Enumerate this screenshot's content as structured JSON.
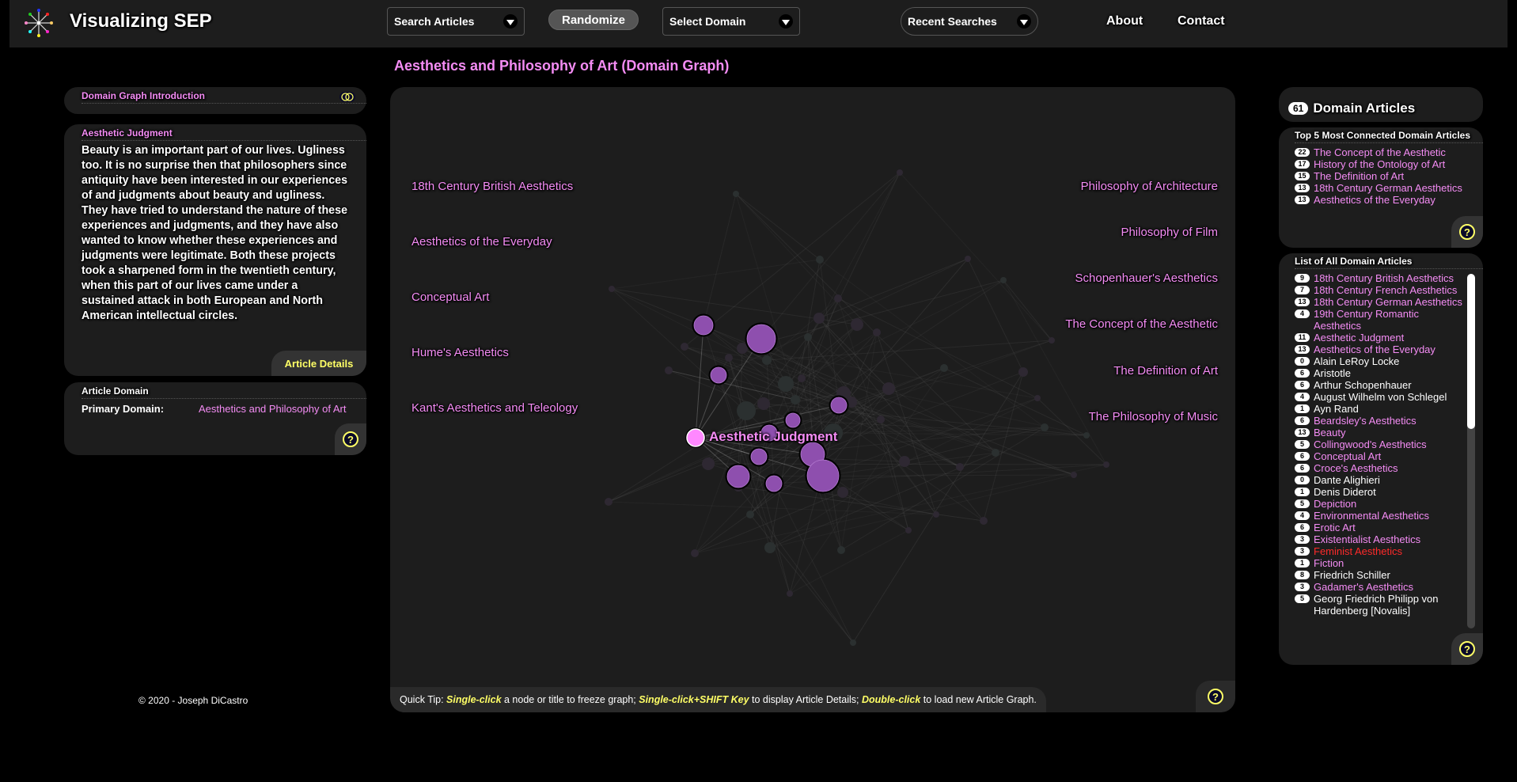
{
  "header": {
    "title": "Visualizing SEP",
    "search_placeholder": "Search Articles",
    "randomize_label": "Randomize",
    "domain_placeholder": "Select Domain",
    "recent_placeholder": "Recent Searches",
    "about_label": "About",
    "contact_label": "Contact"
  },
  "page_title": "Aesthetics and Philosophy of Art (Domain Graph)",
  "left": {
    "intro_heading": "Domain Graph Introduction",
    "article_heading": "Aesthetic Judgment",
    "article_text": "Beauty is an important part of our lives. Ugliness too. It is no surprise then that philosophers since antiquity have been interested in our experiences of and judgments about beauty and ugliness. They have tried to understand the nature of these experiences and judgments, and they have also wanted to know whether these experiences and judgments were legitimate. Both these projects took a sharpened form in the twentieth century, when this part of our lives came under a sustained attack in both European and North American intellectual circles.",
    "article_details_label": "Article Details",
    "domain_heading": "Article Domain",
    "primary_domain_label": "Primary Domain:",
    "primary_domain_value": "Aesthetics and Philosophy of Art",
    "help_label": "?"
  },
  "footer": {
    "copyright": "© 2020 - Joseph DiCastro"
  },
  "graph": {
    "center_label": "Aesthetic Judgment",
    "left_labels": [
      "18th Century British Aesthetics",
      "Aesthetics of the Everyday",
      "Conceptual Art",
      "Hume's Aesthetics",
      "Kant's Aesthetics and Teleology"
    ],
    "right_labels": [
      "Philosophy of Architecture",
      "Philosophy of Film",
      "Schopenhauer's Aesthetics",
      "The Concept of the Aesthetic",
      "The Definition of Art",
      "The Philosophy of Music"
    ],
    "quick_tip": {
      "prefix": "Quick Tip: ",
      "k1": "Single-click",
      "t1": " a node or title to freeze graph; ",
      "k2": "Single-click+SHIFT Key",
      "t2": " to display Article Details; ",
      "k3": "Double-click",
      "t3": " to load new Article Graph."
    },
    "help_label": "?",
    "colors": {
      "active_node": "#ff88ff",
      "neighbor_node": "#8e4fae",
      "faded_node": "#2a2a2e",
      "label": "#f48cf4"
    }
  },
  "right": {
    "count": "61",
    "count_label": "Domain Articles",
    "top5_heading": "Top 5 Most Connected Domain Articles",
    "top5": [
      {
        "n": "22",
        "title": "The Concept of the Aesthetic"
      },
      {
        "n": "17",
        "title": "History of the Ontology of Art"
      },
      {
        "n": "15",
        "title": "The Definition of Art"
      },
      {
        "n": "13",
        "title": "18th Century German Aesthetics"
      },
      {
        "n": "13",
        "title": "Aesthetics of the Everyday"
      }
    ],
    "all_heading": "List of All Domain Articles",
    "all": [
      {
        "n": "9",
        "title": "18th Century British Aesthetics",
        "kind": "topic"
      },
      {
        "n": "7",
        "title": "18th Century French Aesthetics",
        "kind": "topic"
      },
      {
        "n": "13",
        "title": "18th Century German Aesthetics",
        "kind": "topic"
      },
      {
        "n": "4",
        "title": "19th Century Romantic Aesthetics",
        "kind": "topic"
      },
      {
        "n": "11",
        "title": "Aesthetic Judgment",
        "kind": "topic"
      },
      {
        "n": "13",
        "title": "Aesthetics of the Everyday",
        "kind": "topic"
      },
      {
        "n": "0",
        "title": "Alain LeRoy Locke",
        "kind": "person"
      },
      {
        "n": "6",
        "title": "Aristotle",
        "kind": "person"
      },
      {
        "n": "6",
        "title": "Arthur Schopenhauer",
        "kind": "person"
      },
      {
        "n": "4",
        "title": "August Wilhelm von Schlegel",
        "kind": "person"
      },
      {
        "n": "1",
        "title": "Ayn Rand",
        "kind": "person"
      },
      {
        "n": "6",
        "title": "Beardsley's Aesthetics",
        "kind": "topic"
      },
      {
        "n": "13",
        "title": "Beauty",
        "kind": "topic"
      },
      {
        "n": "5",
        "title": "Collingwood's Aesthetics",
        "kind": "topic"
      },
      {
        "n": "6",
        "title": "Conceptual Art",
        "kind": "topic"
      },
      {
        "n": "6",
        "title": "Croce's Aesthetics",
        "kind": "topic"
      },
      {
        "n": "0",
        "title": "Dante Alighieri",
        "kind": "person"
      },
      {
        "n": "1",
        "title": "Denis Diderot",
        "kind": "person"
      },
      {
        "n": "5",
        "title": "Depiction",
        "kind": "topic"
      },
      {
        "n": "4",
        "title": "Environmental Aesthetics",
        "kind": "topic"
      },
      {
        "n": "6",
        "title": "Erotic Art",
        "kind": "topic"
      },
      {
        "n": "3",
        "title": "Existentialist Aesthetics",
        "kind": "topic"
      },
      {
        "n": "3",
        "title": "Feminist Aesthetics",
        "kind": "red"
      },
      {
        "n": "1",
        "title": "Fiction",
        "kind": "topic"
      },
      {
        "n": "8",
        "title": "Friedrich Schiller",
        "kind": "person"
      },
      {
        "n": "3",
        "title": "Gadamer's Aesthetics",
        "kind": "topic"
      },
      {
        "n": "5",
        "title": "Georg Friedrich Philipp von Hardenberg [Novalis]",
        "kind": "person"
      }
    ],
    "help_label": "?"
  }
}
